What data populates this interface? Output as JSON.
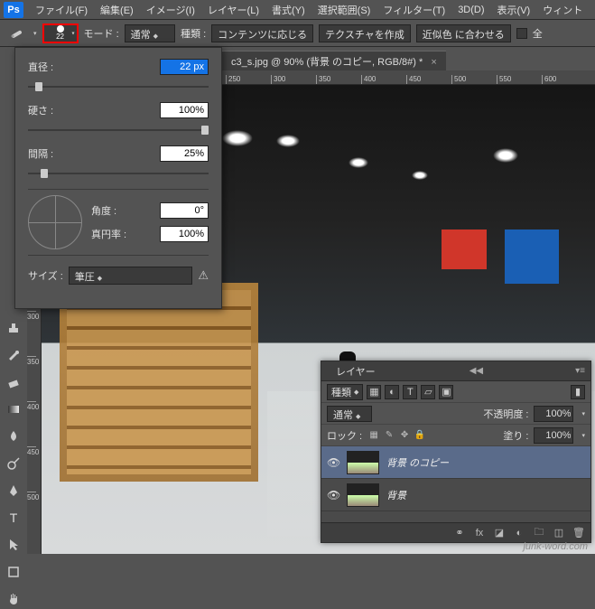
{
  "menu": {
    "items": [
      "ファイル(F)",
      "編集(E)",
      "イメージ(I)",
      "レイヤー(L)",
      "書式(Y)",
      "選択範囲(S)",
      "フィルター(T)",
      "3D(D)",
      "表示(V)",
      "ウィント"
    ]
  },
  "options": {
    "brush_preset_size": "22",
    "mode_label": "モード :",
    "mode_value": "通常",
    "type_label": "種類 :",
    "btn_content_aware": "コンテンツに応じる",
    "btn_create_texture": "テクスチャを作成",
    "btn_proximity": "近似色 に合わせる",
    "all_label": "全"
  },
  "brush_panel": {
    "diameter_label": "直径 :",
    "diameter_value": "22 px",
    "hardness_label": "硬さ :",
    "hardness_value": "100%",
    "spacing_label": "間隔 :",
    "spacing_value": "25%",
    "angle_label": "角度 :",
    "angle_value": "0°",
    "roundness_label": "真円率 :",
    "roundness_value": "100%",
    "size_label": "サイズ :",
    "size_control": "筆圧"
  },
  "document": {
    "tab_title": "c3_s.jpg @ 90% (背景 のコピー, RGB/8#) *"
  },
  "ruler": {
    "h_ticks": [
      "250",
      "300",
      "350",
      "400",
      "450",
      "500",
      "550",
      "600"
    ],
    "v_ticks": [
      "300",
      "350",
      "400",
      "450",
      "500"
    ]
  },
  "layers_panel": {
    "tab": "レイヤー",
    "kind_label": "種類",
    "blend_mode": "通常",
    "opacity_label": "不透明度 :",
    "opacity_value": "100%",
    "lock_label": "ロック :",
    "fill_label": "塗り :",
    "fill_value": "100%",
    "items": [
      {
        "name": "背景 のコピー",
        "visible": true
      },
      {
        "name": "背景",
        "visible": true
      }
    ]
  },
  "watermark": "junk-word.com"
}
